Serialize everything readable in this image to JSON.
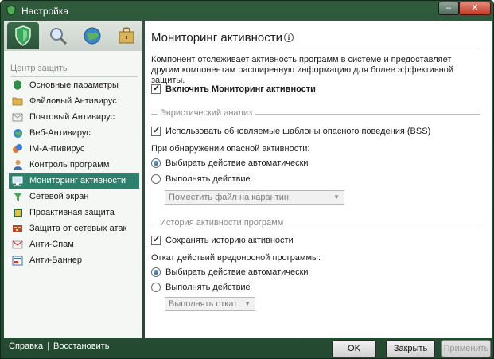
{
  "window": {
    "title": "Настройка",
    "minimize_label": "–",
    "close_label": "✕"
  },
  "sidebar": {
    "tabs": [
      {
        "icon": "shield-icon",
        "active": true
      },
      {
        "icon": "magnifier-icon",
        "active": false
      },
      {
        "icon": "globe-icon",
        "active": false
      },
      {
        "icon": "lock-box-icon",
        "active": false
      }
    ],
    "section_title": "Центр защиты",
    "items": [
      {
        "label": "Основные параметры",
        "icon": "shield-small-icon"
      },
      {
        "label": "Файловый Антивирус",
        "icon": "folder-icon"
      },
      {
        "label": "Почтовый Антивирус",
        "icon": "envelope-icon"
      },
      {
        "label": "Веб-Антивирус",
        "icon": "globe-small-icon"
      },
      {
        "label": "IM-Антивирус",
        "icon": "im-icon"
      },
      {
        "label": "Контроль программ",
        "icon": "person-icon"
      },
      {
        "label": "Мониторинг активности",
        "icon": "monitor-icon",
        "active": true
      },
      {
        "label": "Сетевой экран",
        "icon": "funnel-icon"
      },
      {
        "label": "Проактивная защита",
        "icon": "proactive-icon"
      },
      {
        "label": "Защита от сетевых атак",
        "icon": "network-icon"
      },
      {
        "label": "Анти-Спам",
        "icon": "antispam-icon"
      },
      {
        "label": "Анти-Баннер",
        "icon": "antibanner-icon"
      }
    ]
  },
  "main": {
    "heading": "Мониторинг активности",
    "info_glyph": "i",
    "description": "Компонент отслеживает активность программ в системе и предоставляет другим компонентам расширенную информацию для более эффективной защиты.",
    "enable_label": "Включить Мониторинг активности",
    "enable_checked": true,
    "heuristic": {
      "title": "Эвристический анализ",
      "use_templates_label": "Использовать обновляемые шаблоны опасного поведения (BSS)",
      "use_templates_checked": true,
      "on_detect_label": "При обнаружении опасной активности:",
      "option_auto": "Выбирать действие автоматически",
      "option_manual": "Выполнять действие",
      "selected": "auto",
      "action_value": "Поместить файл на карантин"
    },
    "history": {
      "title": "История активности программ",
      "save_label": "Сохранять историю активности",
      "save_checked": true,
      "rollback_label": "Откат действий вредоносной программы:",
      "option_auto": "Выбирать действие автоматически",
      "option_manual": "Выполнять действие",
      "selected": "auto",
      "action_value": "Выполнять откат"
    }
  },
  "footer": {
    "help_link": "Справка",
    "separator": "|",
    "restore_link": "Восстановить",
    "ok_label": "OK",
    "close_label": "Закрыть",
    "apply_label": "Применить"
  },
  "colors": {
    "frame": "#2f5a3c",
    "active_item": "#2e7f6b"
  }
}
